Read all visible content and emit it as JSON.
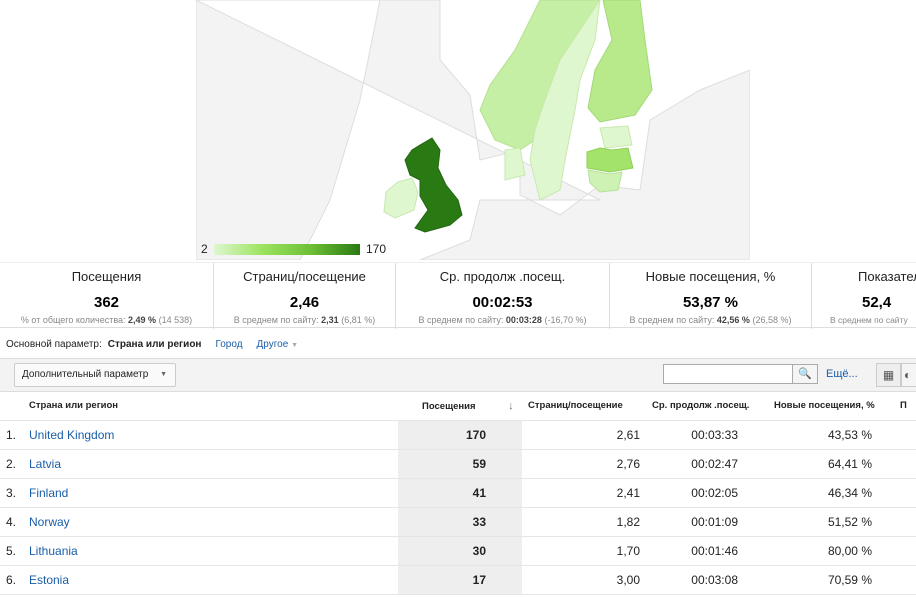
{
  "map": {
    "legend_min": "2",
    "legend_max": "170",
    "colors": {
      "sea": "#ffffff",
      "land": "#f3f3f3",
      "border": "#dddddd",
      "max": "#2a7a14",
      "mid": "#9be35e",
      "low": "#dff7cf"
    }
  },
  "scorecards": [
    {
      "title": "Посещения",
      "value": "362",
      "sub_label": "% от общего количества:",
      "sub_bold": "2,49 %",
      "sub_extra": "(14 538)"
    },
    {
      "title": "Страниц/посещение",
      "value": "2,46",
      "sub_label": "В среднем по сайту:",
      "sub_bold": "2,31",
      "sub_extra": "(6,81 %)"
    },
    {
      "title": "Ср. продолж .посещ.",
      "value": "00:02:53",
      "sub_label": "В среднем по сайту:",
      "sub_bold": "00:03:28",
      "sub_extra": "(-16,70 %)"
    },
    {
      "title": "Новые посещения, %",
      "value": "53,87 %",
      "sub_label": "В среднем по сайту:",
      "sub_bold": "42,56 %",
      "sub_extra": "(26,58 %)"
    },
    {
      "title": "Показател",
      "value": "52,4",
      "sub_label": "В среднем по сайту",
      "sub_bold": "",
      "sub_extra": ""
    }
  ],
  "dimension": {
    "label": "Основной параметр:",
    "active": "Страна или регион",
    "city": "Город",
    "other": "Другое"
  },
  "toolbar": {
    "secondary": "Дополнительный параметр",
    "search_value": "",
    "more": "Ещё..."
  },
  "table": {
    "headers": [
      "Страна или регион",
      "Посещения",
      "Страниц/посещение",
      "Ср. продолж .посещ.",
      "Новые посещения, %",
      "П"
    ],
    "rows": [
      {
        "idx": "1.",
        "country": "United Kingdom",
        "visits": "170",
        "pages": "2,61",
        "duration": "00:03:33",
        "new": "43,53 %"
      },
      {
        "idx": "2.",
        "country": "Latvia",
        "visits": "59",
        "pages": "2,76",
        "duration": "00:02:47",
        "new": "64,41 %"
      },
      {
        "idx": "3.",
        "country": "Finland",
        "visits": "41",
        "pages": "2,41",
        "duration": "00:02:05",
        "new": "46,34 %"
      },
      {
        "idx": "4.",
        "country": "Norway",
        "visits": "33",
        "pages": "1,82",
        "duration": "00:01:09",
        "new": "51,52 %"
      },
      {
        "idx": "5.",
        "country": "Lithuania",
        "visits": "30",
        "pages": "1,70",
        "duration": "00:01:46",
        "new": "80,00 %"
      },
      {
        "idx": "6.",
        "country": "Estonia",
        "visits": "17",
        "pages": "3,00",
        "duration": "00:03:08",
        "new": "70,59 %"
      }
    ]
  }
}
